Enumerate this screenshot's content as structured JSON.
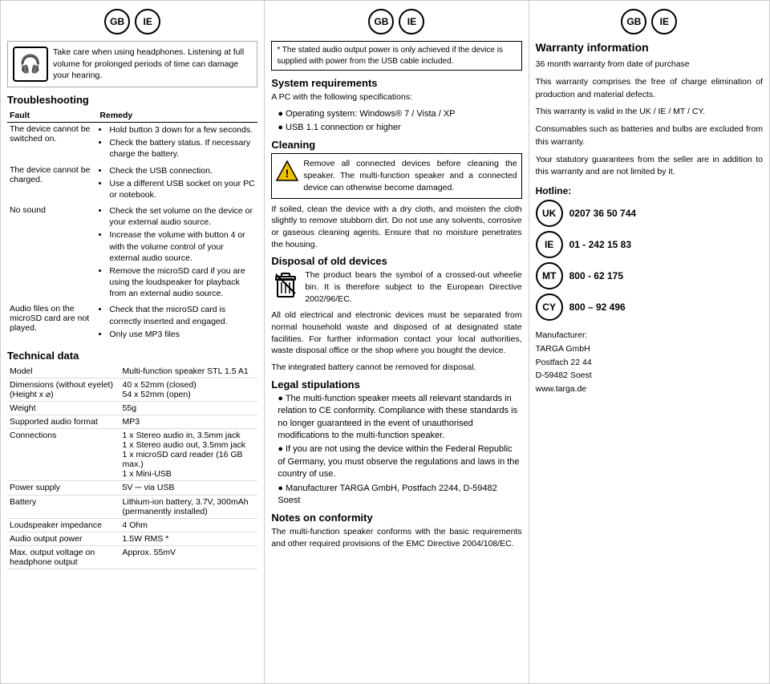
{
  "left": {
    "badges": [
      "GB",
      "IE"
    ],
    "headphone": {
      "text": "Take care when using headphones. Listening at full volume for prolonged periods of time can damage your hearing."
    },
    "troubleshooting": {
      "title": "Troubleshooting",
      "fault_header": "Fault",
      "remedy_header": "Remedy",
      "rows": [
        {
          "fault": "The device cannot be switched on.",
          "remedies": [
            "Hold button 3 down for a few seconds.",
            "Check the battery status. If necessary charge the battery."
          ]
        },
        {
          "fault": "The device cannot be charged.",
          "remedies": [
            "Check the USB connection.",
            "Use a different USB socket on your PC or notebook."
          ]
        },
        {
          "fault": "No sound",
          "remedies": [
            "Check the set volume on the device or your external audio source.",
            "Increase the volume with button 4 or with the volume control of your external audio source.",
            "Remove the microSD card if you are using the loudspeaker for playback from an external audio source."
          ]
        },
        {
          "fault": "Audio files on the microSD card are not played.",
          "remedies": [
            "Check that the microSD card is correctly inserted and engaged.",
            "Only use MP3 files"
          ]
        }
      ]
    },
    "tech": {
      "title": "Technical data",
      "rows": [
        {
          "label": "Model",
          "value": "Multi-function speaker STL 1.5 A1"
        },
        {
          "label": "Dimensions (without eyelet) (Height x ⌀)",
          "value": "40 x 52mm (closed)\n54 x 52mm (open)"
        },
        {
          "label": "Weight",
          "value": "55g"
        },
        {
          "label": "Supported audio format",
          "value": "MP3"
        },
        {
          "label": "Connections",
          "value": "1 x Stereo audio in, 3.5mm jack\n1 x Stereo audio out, 3.5mm jack\n1 x microSD card reader (16 GB max.)\n1 x Mini-USB"
        },
        {
          "label": "Power supply",
          "value": "5V ⎓ via USB"
        },
        {
          "label": "Battery",
          "value": "Lithium-ion battery, 3.7V, 300mAh (permanently installed)"
        },
        {
          "label": "Loudspeaker impedance",
          "value": "4 Ohm"
        },
        {
          "label": "Audio output power",
          "value": "1.5W RMS *"
        },
        {
          "label": "Max. output voltage on headphone output",
          "value": "Approx. 55mV"
        }
      ]
    }
  },
  "mid": {
    "badges": [
      "GB",
      "IE"
    ],
    "footnote": "* The stated audio output power is only achieved if the device is supplied with power from the USB cable included.",
    "system_req": {
      "title": "System requirements",
      "intro": "A PC with the following specifications:",
      "items": [
        "Operating system: Windows® 7 / Vista / XP",
        "USB 1.1 connection or higher"
      ]
    },
    "cleaning": {
      "title": "Cleaning",
      "warn_text": "Remove all connected devices before cleaning the speaker. The multi-function speaker and a connected device can otherwise become damaged.",
      "body": "If soiled, clean the device with a dry cloth, and moisten the cloth slightly to remove stubborn dirt. Do not use any solvents, corrosive or gaseous cleaning agents. Ensure that no moisture penetrates the housing."
    },
    "disposal": {
      "title": "Disposal of old devices",
      "body1": "The product bears the symbol of a crossed-out wheelie bin. It is therefore subject to the European Directive 2002/96/EC.",
      "body2": "All old electrical and electronic devices must be separated from normal household waste and disposed of at designated state facilities. For further information contact your local authorities, waste disposal office or the shop where you bought the device.",
      "body3": "The integrated battery cannot be removed for disposal."
    },
    "legal": {
      "title": "Legal stipulations",
      "items": [
        "The multi-function speaker meets all relevant standards in relation to CE conformity. Compliance with these standards is no longer guaranteed in the event of unauthorised modifications to the multi-function speaker.",
        "If you are not using the device within the Federal Republic of Germany, you must observe the regulations and laws in the country of use.",
        "Manufacturer TARGA GmbH, Postfach 2244, D-59482 Soest"
      ]
    },
    "conformity": {
      "title": "Notes on conformity",
      "body": "The multi-function speaker conforms with the basic requirements and other required provisions of the EMC Directive 2004/108/EC."
    }
  },
  "right": {
    "badges": [
      "GB",
      "IE"
    ],
    "warranty": {
      "title": "Warranty information",
      "para1": "36 month warranty from date of purchase",
      "para2": "This warranty comprises the free of charge elimination of production and material defects.",
      "para3": "This warranty is valid in the UK / IE / MT / CY.",
      "para4": "Consumables such as batteries and bulbs are excluded from this warranty.",
      "para5": "Your statutory guarantees from the seller are in addition to this warranty and are not limited by it."
    },
    "hotline": {
      "label": "Hotline:",
      "numbers": [
        {
          "region": "UK",
          "number": "0207 36 50 744"
        },
        {
          "region": "IE",
          "number": "01 - 242 15 83"
        },
        {
          "region": "MT",
          "number": "800 - 62 175"
        },
        {
          "region": "CY",
          "number": "800 – 92 496"
        }
      ]
    },
    "manufacturer": {
      "label": "Manufacturer:",
      "name": "TARGA GmbH",
      "address1": "Postfach 22 44",
      "address2": "D-59482 Soest",
      "website": "www.targa.de"
    }
  }
}
